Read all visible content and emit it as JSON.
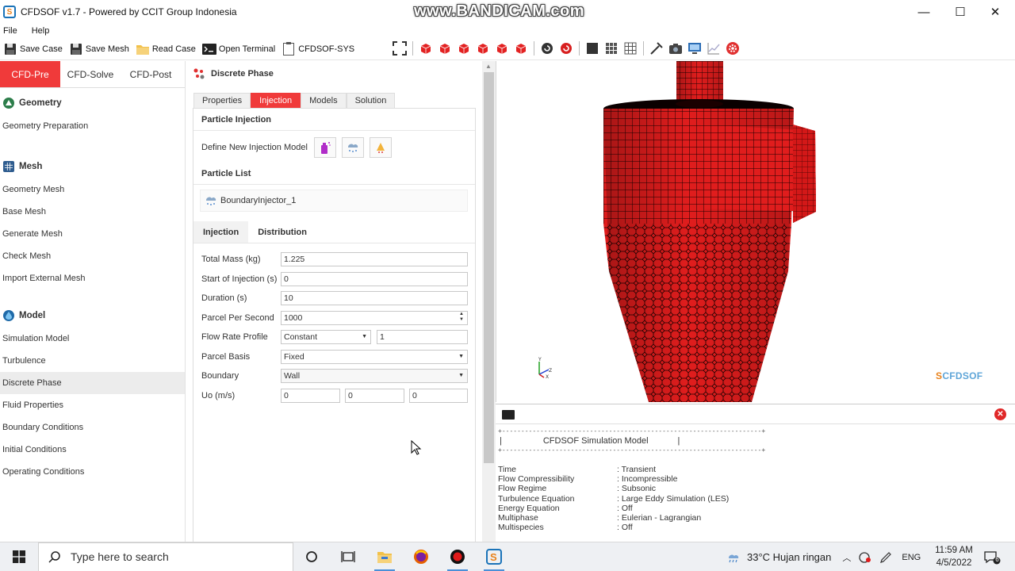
{
  "window": {
    "title": "CFDSOF v1.7 - Powered by CCIT Group Indonesia",
    "watermark": "www.BANDICAM.com",
    "minimize": "—",
    "maximize": "☐",
    "close": "✕"
  },
  "menu": [
    "File",
    "Help"
  ],
  "toolbar": {
    "save_case": "Save Case",
    "save_mesh": "Save Mesh",
    "read_case": "Read Case",
    "open_terminal": "Open Terminal",
    "cfdsof_sys": "CFDSOF-SYS"
  },
  "left_panel": {
    "tabs": [
      "CFD-Pre",
      "CFD-Solve",
      "CFD-Post"
    ],
    "active_tab": "CFD-Pre",
    "sections": [
      {
        "title": "Geometry",
        "items": [
          "Geometry Preparation"
        ]
      },
      {
        "title": "Mesh",
        "items": [
          "Geometry Mesh",
          "Base Mesh",
          "Generate Mesh",
          "Check Mesh",
          "Import External Mesh"
        ]
      },
      {
        "title": "Model",
        "items": [
          "Simulation Model",
          "Turbulence",
          "Discrete Phase",
          "Fluid Properties",
          "Boundary Conditions",
          "Initial Conditions",
          "Operating Conditions"
        ]
      }
    ],
    "selected_item": "Discrete Phase"
  },
  "middle_panel": {
    "header": "Discrete Phase",
    "tabs": [
      "Properties",
      "Injection",
      "Models",
      "Solution"
    ],
    "active_tab": "Injection",
    "particle_injection_title": "Particle Injection",
    "define_label": "Define New Injection Model",
    "particle_list_title": "Particle List",
    "particle_list": [
      "BoundaryInjector_1"
    ],
    "sub_tabs": [
      "Injection",
      "Distribution"
    ],
    "active_sub_tab": "Distribution",
    "form": {
      "total_mass": {
        "label": "Total Mass (kg)",
        "value": "1.225"
      },
      "start_of_injection": {
        "label": "Start of Injection (s)",
        "value": "0"
      },
      "duration": {
        "label": "Duration (s)",
        "value": "10"
      },
      "parcel_per_second": {
        "label": "Parcel Per Second",
        "value": "1000"
      },
      "flow_rate_profile": {
        "label": "Flow Rate Profile",
        "value": "Constant",
        "value2": "1"
      },
      "parcel_basis": {
        "label": "Parcel Basis",
        "value": "Fixed"
      },
      "boundary": {
        "label": "Boundary",
        "value": "Wall"
      },
      "uo": {
        "label": "Uo (m/s)",
        "x": "0",
        "y": "0",
        "z": "0"
      }
    }
  },
  "viewport": {
    "brand": "CFDSOF",
    "axis_y": "Y",
    "axis_z": "Z",
    "axis_x": "X"
  },
  "console": {
    "banner_line": "+--------------------------------------------------------------------+",
    "banner_title": "CFDSOF Simulation Model",
    "rows": [
      {
        "key": "Time",
        "value": ": Transient"
      },
      {
        "key": "Flow Compressibility",
        "value": ": Incompressible"
      },
      {
        "key": "Flow Regime",
        "value": ": Subsonic"
      },
      {
        "key": "Turbulence Equation",
        "value": ": Large Eddy Simulation (LES)"
      },
      {
        "key": "Energy Equation",
        "value": ": Off"
      },
      {
        "key": "Multiphase",
        "value": ": Eulerian - Lagrangian"
      },
      {
        "key": "Multispecies",
        "value": ": Off"
      }
    ]
  },
  "taskbar": {
    "search_placeholder": "Type here to search",
    "weather": "33°C  Hujan ringan",
    "lang": "ENG",
    "time": "11:59 AM",
    "date": "4/5/2022",
    "notif_count": "6"
  },
  "colors": {
    "accent": "#f03a3a",
    "mesh": "#e02020"
  }
}
